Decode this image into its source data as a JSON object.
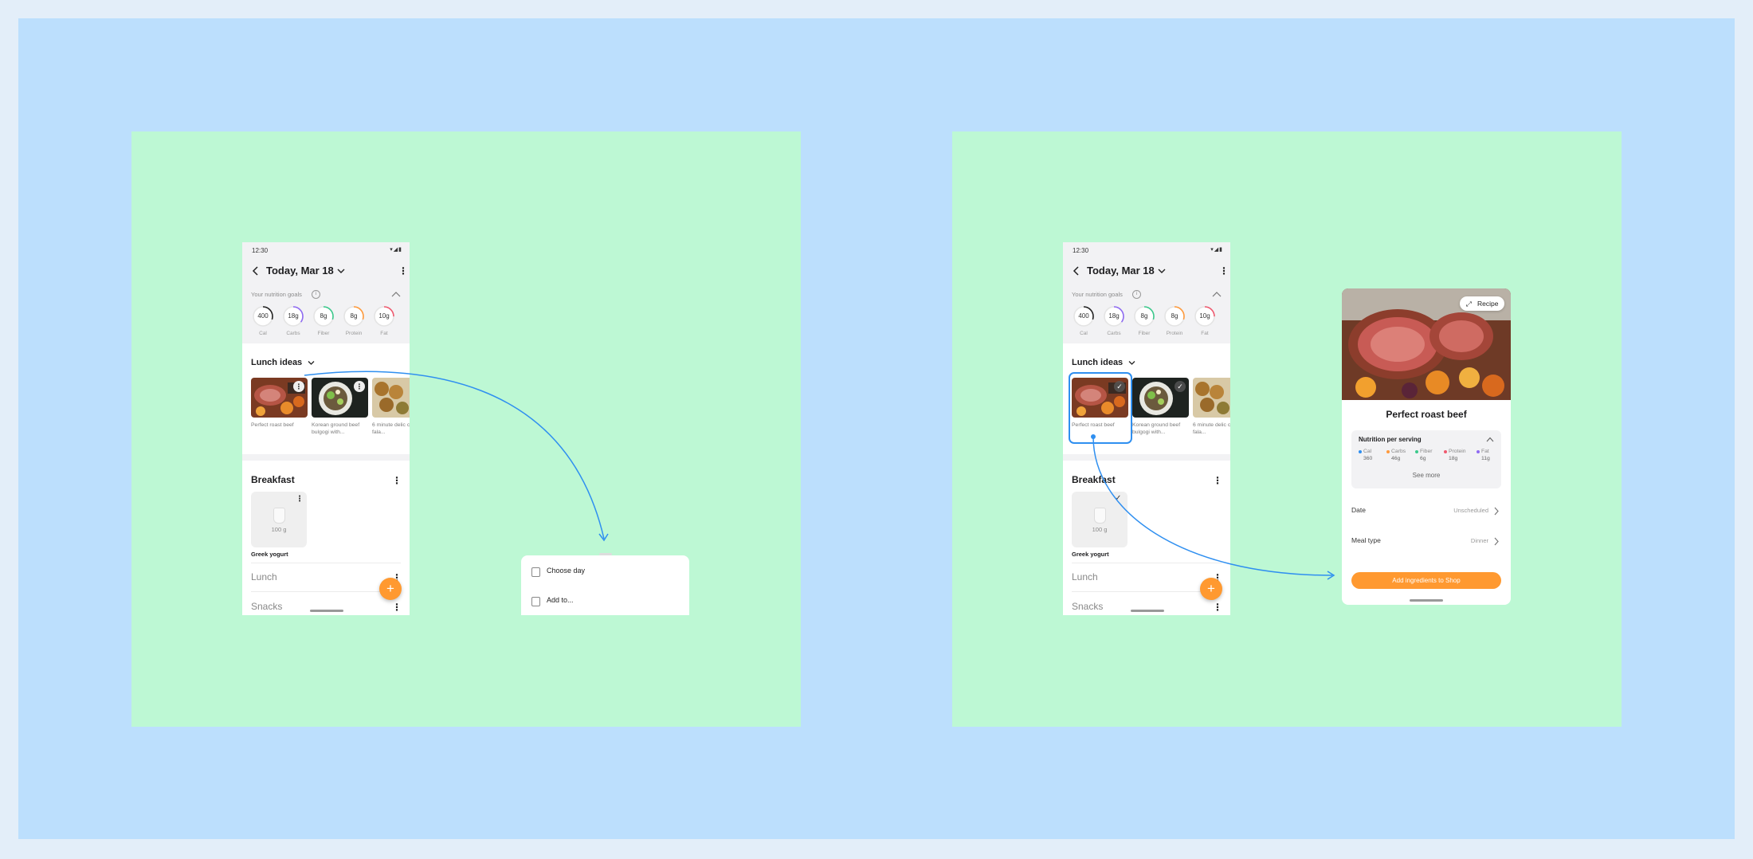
{
  "status": {
    "time": "12:30"
  },
  "header": {
    "date_title": "Today, Mar 18"
  },
  "goals": {
    "label": "Your nutrition goals",
    "items": [
      {
        "value": "400",
        "unit": "",
        "name": "Cal",
        "progress": 0.3,
        "color": "#222222"
      },
      {
        "value": "18",
        "unit": "g",
        "name": "Carbs",
        "progress": 0.35,
        "color": "#8f6bf2"
      },
      {
        "value": "8",
        "unit": "g",
        "name": "Fiber",
        "progress": 0.3,
        "color": "#3cc98c"
      },
      {
        "value": "8",
        "unit": "g",
        "name": "Protein",
        "progress": 0.3,
        "color": "#ff9a3c"
      },
      {
        "value": "10",
        "unit": "g",
        "name": "Fat",
        "progress": 0.25,
        "color": "#ef5a6f"
      }
    ]
  },
  "lunch_ideas": {
    "title": "Lunch ideas",
    "cards": [
      {
        "caption": "Perfect roast beef"
      },
      {
        "caption": "Korean ground beef bulgogi with..."
      },
      {
        "caption": "6 minute delic chickpea fala..."
      }
    ]
  },
  "breakfast": {
    "title": "Breakfast",
    "food_weight": "100 g",
    "food_name": "Greek yogurt"
  },
  "meals": {
    "lunch": "Lunch",
    "snacks": "Snacks"
  },
  "fab": {
    "symbol": "+"
  },
  "sheet": {
    "items": [
      {
        "label": "Choose day"
      },
      {
        "label": "Add to..."
      }
    ]
  },
  "detail": {
    "recipe_chip": "Recipe",
    "title": "Perfect roast beef",
    "nutrition_title": "Nutrition per serving",
    "nutrients": [
      {
        "name": "Cal",
        "value": "360",
        "color": "#2f8ff0"
      },
      {
        "name": "Carbs",
        "value": "46g",
        "color": "#ff9a3c"
      },
      {
        "name": "Fiber",
        "value": "6g",
        "color": "#3cc98c"
      },
      {
        "name": "Protein",
        "value": "18g",
        "color": "#ef5a6f"
      },
      {
        "name": "Fat",
        "value": "11g",
        "color": "#8f6bf2"
      }
    ],
    "see_more": "See more",
    "date_label": "Date",
    "date_value": "Unscheduled",
    "meal_type_label": "Meal type",
    "meal_type_value": "Dinner",
    "cta": "Add ingredients to Shop"
  },
  "colors": {
    "accent": "#ff9930",
    "flow_arrow": "#2f8ff0",
    "board": "#bdf8d4",
    "canvas": "#bcdffd"
  }
}
